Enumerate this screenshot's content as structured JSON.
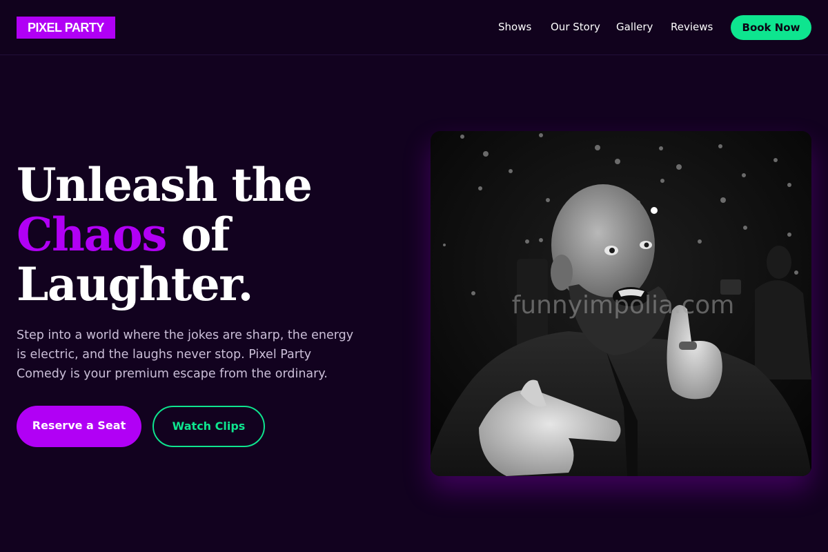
{
  "header": {
    "logo": "PIXEL PARTY",
    "nav": [
      "Shows",
      "Our Story",
      "Gallery",
      "Reviews"
    ],
    "cta": "Book Now"
  },
  "hero": {
    "headline_line1": "Unleash the",
    "headline_accent": "Chaos",
    "headline_line2_rest": " of",
    "headline_line3": "Laughter.",
    "subtext": "Step into a world where the jokes are sharp, the energy is electric, and the laughs never stop. Pixel Party Comedy is your premium escape from the ordinary.",
    "primary_button": "Reserve a Seat",
    "secondary_button": "Watch Clips",
    "image_watermark": "funnyimpolia.com"
  },
  "colors": {
    "background": "#12021f",
    "accent_purple": "#b100f5",
    "accent_green": "#0ee58f"
  },
  "icons": {
    "hero_image": "comedian-photo"
  }
}
